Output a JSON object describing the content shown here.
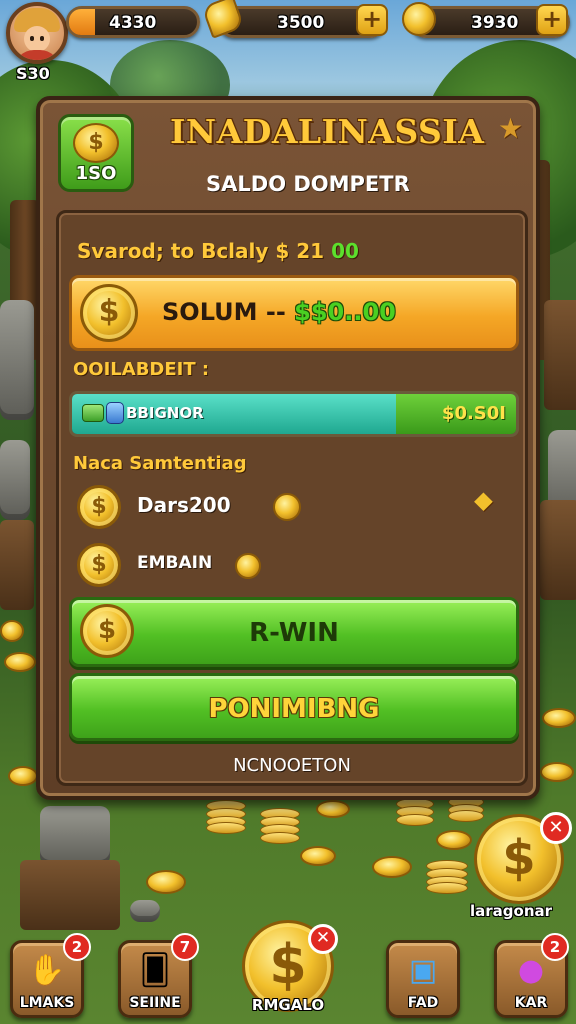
{
  "topbar": {
    "player_level": "S30",
    "resources": [
      {
        "value": "4330",
        "icon": "coin-icon",
        "fill_fraction": 0.2
      },
      {
        "value": "3500",
        "icon": "leaf-gem-icon"
      },
      {
        "value": "3930",
        "icon": "coin-icon"
      }
    ],
    "plus": "+"
  },
  "panel": {
    "badge_value": "1SO",
    "badge_coin_symbol": "$",
    "title": "INADALINASSIA",
    "subtitle": "SALDO DOMPETR",
    "saved_prefix": "Svarod; to Bclaly $ 21",
    "saved_suffix": "00",
    "sum_prefix": "SOLUM --",
    "sum_value": "$$0..00",
    "sum_coin_symbol": "$",
    "balance_label": "OOILABDEIT :",
    "progress": {
      "label": "BBIGNOR",
      "value": "$0.S0I",
      "fill_fraction": 0.73
    },
    "section_label": "Naca Samtentiag",
    "rewards": [
      {
        "label": "Dars200"
      },
      {
        "label": "EMBAIN"
      }
    ],
    "win_button": "R-WIN",
    "win_coin_symbol": "$",
    "second_button": "PONIMIBNG",
    "footer": "NCNOOETON"
  },
  "corner": {
    "label": "laragonar",
    "symbol": "$",
    "close": "✕"
  },
  "bottom_nav": [
    {
      "label": "LMAKS",
      "badge": "2",
      "icon": "hand-icon"
    },
    {
      "label": "SEIINE",
      "badge": "7",
      "icon": "cards-icon"
    },
    {
      "label": "RMGALO",
      "badge": "✕",
      "icon": "coin-icon",
      "symbol": "$"
    },
    {
      "label": "FAD",
      "icon": "chest-icon"
    },
    {
      "label": "KAR",
      "badge": "2",
      "icon": "potion-icon"
    }
  ],
  "colors": {
    "accent_gold": "#ffc93a",
    "button_green": "#52c024",
    "panel_brown": "#6b4a2e"
  }
}
